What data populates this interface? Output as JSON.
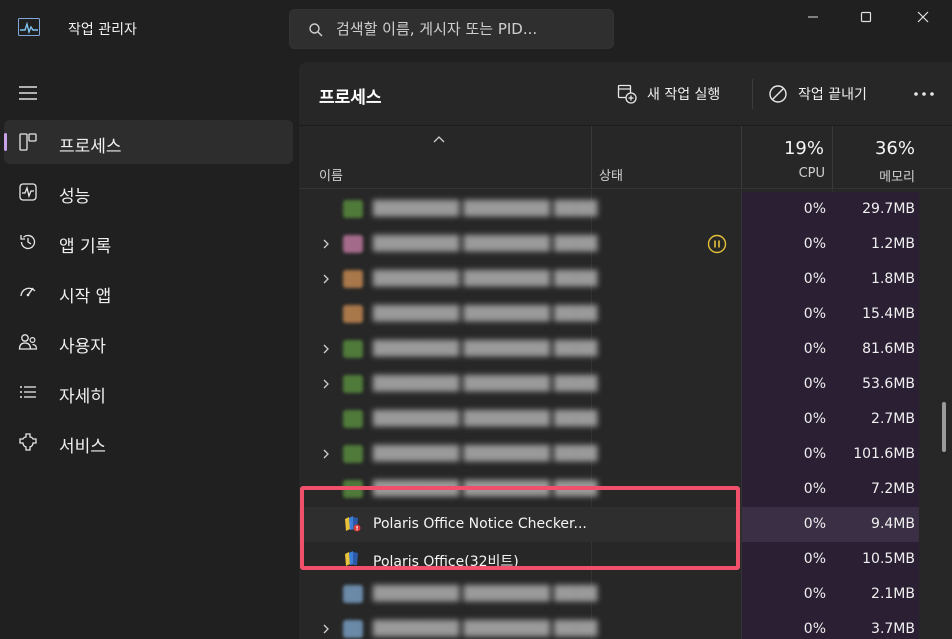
{
  "app": {
    "title": "작업 관리자"
  },
  "search": {
    "placeholder": "검색할 이름, 게시자 또는 PID..."
  },
  "sidebar": {
    "items": [
      {
        "label": "프로세스",
        "icon": "processes-icon",
        "active": true
      },
      {
        "label": "성능",
        "icon": "performance-icon"
      },
      {
        "label": "앱 기록",
        "icon": "history-icon"
      },
      {
        "label": "시작 앱",
        "icon": "startup-icon"
      },
      {
        "label": "사용자",
        "icon": "users-icon"
      },
      {
        "label": "자세히",
        "icon": "details-icon"
      },
      {
        "label": "서비스",
        "icon": "services-icon"
      }
    ]
  },
  "main": {
    "title": "프로세스",
    "toolbar": {
      "run_task": "새 작업 실행",
      "end_task": "작업 끝내기"
    }
  },
  "columns": {
    "name": "이름",
    "status": "상태",
    "cpu_pct": "19%",
    "cpu": "CPU",
    "mem_pct": "36%",
    "mem": "메모리"
  },
  "rows": [
    {
      "name": "",
      "cpu": "0%",
      "mem": "29.7MB",
      "expandable": false,
      "blurred": true,
      "icon_color": "#4f7a3a"
    },
    {
      "name": "",
      "cpu": "0%",
      "mem": "1.2MB",
      "expandable": true,
      "blurred": true,
      "paused": true,
      "icon_color": "#a46a8a"
    },
    {
      "name": "",
      "cpu": "0%",
      "mem": "1.8MB",
      "expandable": true,
      "blurred": true,
      "icon_color": "#a9784a"
    },
    {
      "name": "",
      "cpu": "0%",
      "mem": "15.4MB",
      "expandable": false,
      "blurred": true,
      "icon_color": "#a9784a"
    },
    {
      "name": "",
      "cpu": "0%",
      "mem": "81.6MB",
      "expandable": true,
      "blurred": true,
      "icon_color": "#4f7a3a"
    },
    {
      "name": "",
      "cpu": "0%",
      "mem": "53.6MB",
      "expandable": true,
      "blurred": true,
      "icon_color": "#4f7a3a"
    },
    {
      "name": "",
      "cpu": "0%",
      "mem": "2.7MB",
      "expandable": false,
      "blurred": true,
      "icon_color": "#4f7a3a"
    },
    {
      "name": "",
      "cpu": "0%",
      "mem": "101.6MB",
      "expandable": true,
      "blurred": true,
      "icon_color": "#4f7a3a"
    },
    {
      "name": "",
      "cpu": "0%",
      "mem": "7.2MB",
      "expandable": false,
      "blurred": true,
      "icon_color": "#4f7a3a"
    },
    {
      "name": "Polaris Office Notice Checker...",
      "cpu": "0%",
      "mem": "9.4MB",
      "expandable": false,
      "blurred": false,
      "highlighted": true,
      "icon_color": "#3d7fd6"
    },
    {
      "name": "Polaris Office(32비트)",
      "cpu": "0%",
      "mem": "10.5MB",
      "expandable": false,
      "blurred": false,
      "icon_color": "#3d7fd6"
    },
    {
      "name": "",
      "cpu": "0%",
      "mem": "2.1MB",
      "expandable": false,
      "blurred": true,
      "icon_color": "#6a8aa8"
    },
    {
      "name": "",
      "cpu": "0%",
      "mem": "3.7MB",
      "expandable": true,
      "blurred": true,
      "icon_color": "#6a8aa8"
    }
  ],
  "colors": {
    "accent": "#c7a0e8",
    "highlight_box": "#f0506a",
    "paused": "#e3c23a"
  }
}
